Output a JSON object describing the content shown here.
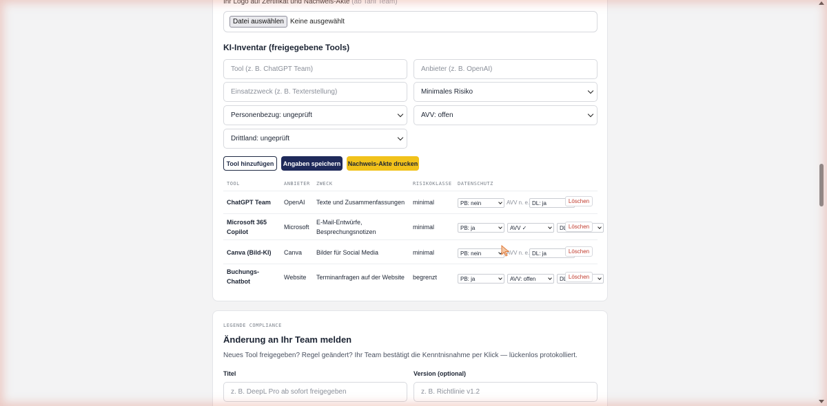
{
  "upload": {
    "hint": "Ihr Logo auf Zertifikat und Nachweis-Akte",
    "hint_muted": "(ab Tarif Team)",
    "button_label": "Datei auswählen",
    "status": "Keine ausgewählt"
  },
  "inventory": {
    "title": "KI-Inventar (freigegebene Tools)",
    "tool_placeholder": "Tool (z. B. ChatGPT Team)",
    "provider_placeholder": "Anbieter (z. B. OpenAI)",
    "purpose_placeholder": "Einsatzzweck (z. B. Texterstellung)",
    "risk_select": "Minimales Risiko",
    "personal_select": "Personenbezug: ungeprüft",
    "avv_select": "AVV: offen",
    "third_country_select": "Drittland: ungeprüft",
    "add_button": "Tool hinzufügen",
    "save_button": "Angaben speichern",
    "print_button": "Nachweis-Akte drucken",
    "columns": [
      "TOOL",
      "ANBIETER",
      "ZWECK",
      "RISIKOKLASSE",
      "DATENSCHUTZ"
    ],
    "rows": [
      {
        "tool": "ChatGPT Team",
        "provider": "OpenAI",
        "purpose": "Texte und Zusammenfassungen",
        "risk": "minimal",
        "pb": "PB: nein",
        "avv": "AVV n. e.",
        "dl": "DL: ja",
        "delete": "Löschen"
      },
      {
        "tool": "Microsoft 365 Copilot",
        "provider": "Microsoft",
        "purpose": "E-Mail-Entwürfe, Besprechungsnotizen",
        "risk": "minimal",
        "pb": "PB: ja",
        "avv": "AVV ✓",
        "dl": "DL: ja",
        "delete": "Löschen"
      },
      {
        "tool": "Canva (Bild-KI)",
        "provider": "Canva",
        "purpose": "Bilder für Social Media",
        "risk": "minimal",
        "pb": "PB: nein",
        "avv": "AVV n. e.",
        "dl": "DL: ja",
        "delete": "Löschen"
      },
      {
        "tool": "Buchungs-Chatbot",
        "provider": "Website",
        "purpose": "Terminanfragen auf der Website",
        "risk": "begrenzt",
        "pb": "PB: ja",
        "avv": "AVV: offen",
        "dl": "DL: nein",
        "delete": "Löschen"
      }
    ]
  },
  "change": {
    "legend": "LEGENDE COMPLIANCE",
    "title": "Änderung an Ihr Team melden",
    "description": "Neues Tool freigegeben? Regel geändert? Ihr Team bestätigt die Kenntnisnahme per Klick — lückenlos protokolliert.",
    "title_label": "Titel",
    "version_label": "Version (optional)",
    "title_placeholder": "z. B. DeepL Pro ab sofort freigegeben",
    "version_placeholder": "z. B. Richtlinie v1.2"
  },
  "colors": {
    "navy": "#1f2a5a",
    "yellow": "#f1c21b",
    "delete_red": "#c0392b"
  }
}
